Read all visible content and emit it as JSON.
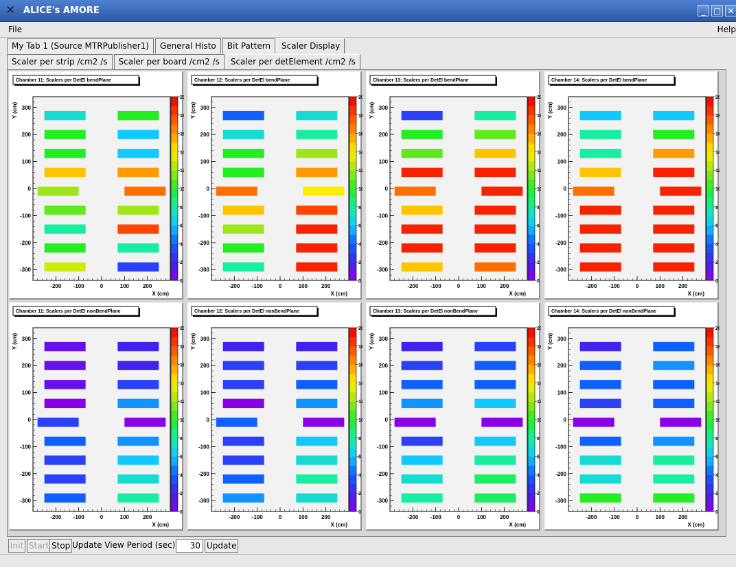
{
  "window": {
    "title": "ALICE's AMORE"
  },
  "menu": {
    "file": "File",
    "help": "Help"
  },
  "tabs_main": [
    {
      "label": "My Tab 1 (Source MTRPublisher1)"
    },
    {
      "label": "General Histo"
    },
    {
      "label": "Bit Pattern"
    },
    {
      "label": "Scaler Display"
    }
  ],
  "tabs_sub": [
    {
      "label": "Scaler per strip /cm2 /s"
    },
    {
      "label": "Scaler per board /cm2 /s"
    },
    {
      "label": "Scaler per detElement /cm2 /s"
    }
  ],
  "controls": {
    "init": "Init",
    "start": "Start",
    "stop": "Stop",
    "period_label": "Update View Period (sec)",
    "period_value": "30",
    "update": "Update"
  },
  "plot": {
    "ylabel": "Y (cm)",
    "xlabel": "X (cm)",
    "yticks": [
      "300",
      "200",
      "100",
      "0",
      "-100",
      "-200",
      "-300"
    ],
    "xticks": [
      "-200",
      "-100",
      "0",
      "100",
      "200"
    ],
    "zticks": [
      "20",
      "18",
      "16",
      "14",
      "12",
      "10",
      "8",
      "6",
      "4",
      "2",
      "0"
    ]
  },
  "chart_data": [
    {
      "type": "heatmap",
      "title": "Chamber 11: Scalers per DetEl bendPlane",
      "zlim": [
        0,
        20
      ],
      "left": [
        7,
        10,
        10,
        15,
        12,
        11,
        8,
        10,
        13
      ],
      "right": [
        10,
        6,
        6,
        16,
        17,
        12,
        18,
        8,
        3
      ]
    },
    {
      "type": "heatmap",
      "title": "Chamber 12: Scalers per DetEl bendPlane",
      "zlim": [
        0,
        20
      ],
      "left": [
        4,
        7,
        10,
        10,
        17,
        15,
        12,
        10,
        8
      ],
      "right": [
        7,
        8,
        12,
        16,
        14,
        18,
        19,
        19,
        19
      ]
    },
    {
      "type": "heatmap",
      "title": "Chamber 13: Scalers per DetEl bendPlane",
      "zlim": [
        0,
        20
      ],
      "left": [
        3,
        10,
        11,
        19,
        17,
        15,
        19,
        19,
        15
      ],
      "right": [
        8,
        11,
        15,
        19,
        19,
        19,
        19,
        19,
        17
      ]
    },
    {
      "type": "heatmap",
      "title": "Chamber 14: Scalers per DetEl bendPlane",
      "zlim": [
        0,
        20
      ],
      "left": [
        6,
        8,
        8,
        15,
        17,
        19,
        19,
        19,
        19
      ],
      "right": [
        6,
        10,
        16,
        19,
        19,
        19,
        19,
        19,
        19
      ]
    },
    {
      "type": "heatmap",
      "title": "Chamber 11: Scalers per DetEl nonBendPlane",
      "zlim": [
        0,
        20
      ],
      "left": [
        1,
        1,
        1,
        0,
        3,
        4,
        3,
        3,
        4
      ],
      "right": [
        2,
        2,
        3,
        5,
        0,
        5,
        6,
        7,
        8
      ]
    },
    {
      "type": "heatmap",
      "title": "Chamber 12: Scalers per DetEl nonBendPlane",
      "zlim": [
        0,
        20
      ],
      "left": [
        2,
        3,
        3,
        0,
        4,
        3,
        3,
        4,
        5
      ],
      "right": [
        2,
        3,
        4,
        5,
        0,
        6,
        7,
        8,
        7
      ]
    },
    {
      "type": "heatmap",
      "title": "Chamber 13: Scalers per DetEl nonBendPlane",
      "zlim": [
        0,
        20
      ],
      "left": [
        2,
        3,
        4,
        5,
        0,
        3,
        6,
        7,
        8
      ],
      "right": [
        3,
        4,
        4,
        6,
        0,
        6,
        8,
        9,
        9
      ]
    },
    {
      "type": "heatmap",
      "title": "Chamber 14: Scalers per DetEl nonBendPlane",
      "zlim": [
        0,
        20
      ],
      "left": [
        2,
        4,
        4,
        3,
        0,
        4,
        7,
        7,
        10
      ],
      "right": [
        4,
        5,
        4,
        4,
        0,
        5,
        8,
        8,
        10
      ]
    }
  ]
}
